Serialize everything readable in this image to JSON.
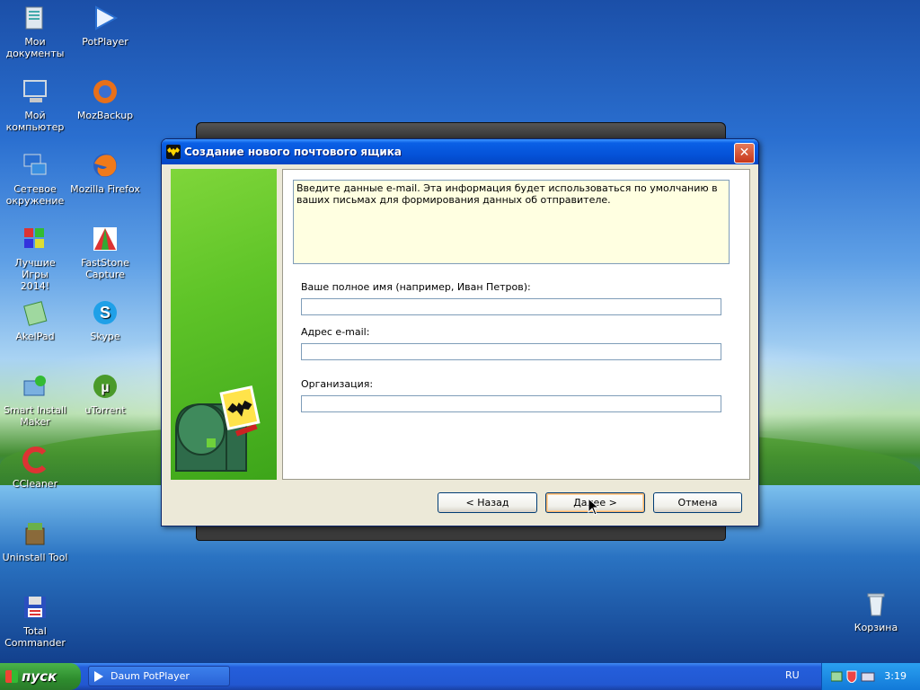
{
  "desktop": {
    "icons": [
      {
        "id": "my-documents",
        "label": "Мои\nдокументы",
        "icon": "folder-docs-icon"
      },
      {
        "id": "potplayer",
        "label": "PotPlayer",
        "icon": "potplayer-icon"
      },
      {
        "id": "my-computer",
        "label": "Мой\nкомпьютер",
        "icon": "computer-icon"
      },
      {
        "id": "mozbackup",
        "label": "MozBackup",
        "icon": "mozbackup-icon"
      },
      {
        "id": "network",
        "label": "Сетевое\nокружение",
        "icon": "network-icon"
      },
      {
        "id": "firefox",
        "label": "Mozilla Firefox",
        "icon": "firefox-icon"
      },
      {
        "id": "best-games",
        "label": "Лучшие Игры\n2014!",
        "icon": "games-icon"
      },
      {
        "id": "faststone",
        "label": "FastStone\nCapture",
        "icon": "faststone-icon"
      },
      {
        "id": "akelpad",
        "label": "AkelPad",
        "icon": "akelpad-icon"
      },
      {
        "id": "skype",
        "label": "Skype",
        "icon": "skype-icon"
      },
      {
        "id": "smart-install",
        "label": "Smart Install\nMaker",
        "icon": "smart-install-icon"
      },
      {
        "id": "utorrent",
        "label": "uTorrent",
        "icon": "utorrent-icon"
      },
      {
        "id": "ccleaner",
        "label": "CCleaner",
        "icon": "ccleaner-icon"
      },
      {
        "id": "uninstall-tool",
        "label": "Uninstall Tool",
        "icon": "uninstall-tool-icon"
      },
      {
        "id": "total-commander",
        "label": "Total\nCommander",
        "icon": "floppy-icon"
      },
      {
        "id": "recycle-bin",
        "label": "Корзина",
        "icon": "recycle-bin-icon"
      }
    ]
  },
  "dialog": {
    "title": "Создание нового почтового ящика",
    "info_text": "Введите данные e-mail. Эта информация будет использоваться по умолчанию в ваших письмах для формирования данных об отправителе.",
    "fields": {
      "fullname_label": "Ваше полное имя (например, Иван Петров):",
      "fullname_value": "",
      "email_label": "Адрес e-mail:",
      "email_value": "",
      "org_label": "Организация:",
      "org_value": ""
    },
    "buttons": {
      "back": "<  Назад",
      "next": "Далее  >",
      "cancel": "Отмена"
    },
    "accent": "#5fc428"
  },
  "taskbar": {
    "start_label": "пуск",
    "task_item": "Daum PotPlayer",
    "language": "RU",
    "clock": "3:19"
  }
}
